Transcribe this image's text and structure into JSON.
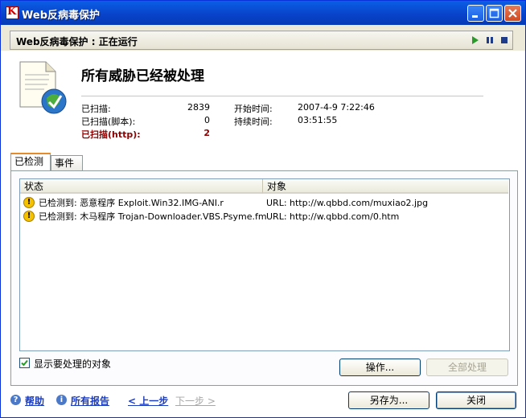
{
  "window": {
    "title": "Web反病毒保护"
  },
  "status": {
    "text": "Web反病毒保护 : 正在运行"
  },
  "summary": {
    "headline": "所有威胁已经被处理",
    "scanned_label": "已扫描:",
    "scanned_value": "2839",
    "scanned_script_label": "已扫描(脚本):",
    "scanned_script_value": "0",
    "scanned_http_label": "已扫描(http):",
    "scanned_http_value": "2",
    "start_label": "开始时间:",
    "start_value": "2007-4-9 7:22:46",
    "duration_label": "持续时间:",
    "duration_value": "03:51:55"
  },
  "tabs": [
    {
      "label": "已检测"
    },
    {
      "label": "事件"
    }
  ],
  "table": {
    "columns": [
      "状态",
      "对象"
    ],
    "rows": [
      {
        "status": "已检测到: 恶意程序 Exploit.Win32.IMG-ANI.r",
        "object": "URL: http://w.qbbd.com/muxiao2.jpg"
      },
      {
        "status": "已检测到: 木马程序 Trojan-Downloader.VBS.Psyme.fm",
        "object": "URL: http://w.qbbd.com/0.htm"
      }
    ]
  },
  "options": {
    "show_label": "显示要处理的对象",
    "show_checked": true
  },
  "buttons": {
    "action": "操作...",
    "process_all": "全部处理",
    "save_as": "另存为...",
    "close": "关闭"
  },
  "footer": {
    "help": "帮助",
    "all_reports": "所有报告",
    "prev": "< 上一步",
    "next": "下一步 >"
  }
}
